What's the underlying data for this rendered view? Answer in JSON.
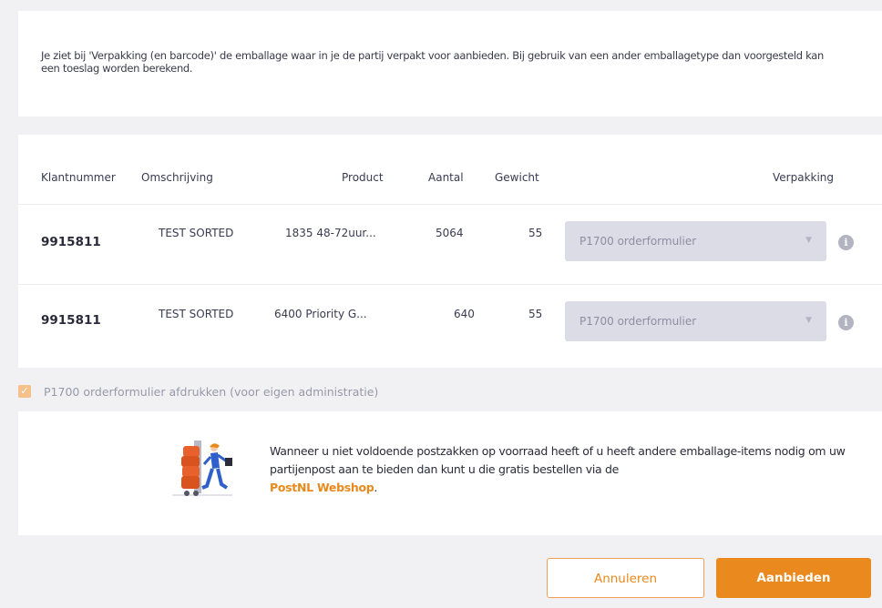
{
  "intro": {
    "text": "Je ziet bij 'Verpakking (en barcode)' de emballage waar in je de partij verpakt voor aanbieden. Bij gebruik van een ander emballagetype dan voorgesteld kan een toeslag worden berekend."
  },
  "table": {
    "headers": {
      "klantnummer": "Klantnummer",
      "omschrijving": "Omschrijving",
      "product": "Product",
      "aantal": "Aantal",
      "gewicht": "Gewicht",
      "verpakking": "Verpakking"
    },
    "rows": [
      {
        "klantnummer": "9915811",
        "omschrijving": "TEST SORTED",
        "product": "1835 48-72uur...",
        "aantal": "5064",
        "gewicht": "55",
        "verpakking": "P1700 orderformulier"
      },
      {
        "klantnummer": "9915811",
        "omschrijving": "TEST SORTED",
        "product": "6400 Priority G...",
        "aantal": "640",
        "gewicht": "55",
        "verpakking": "P1700 orderformulier"
      }
    ]
  },
  "print_option": {
    "label": "P1700 orderformulier afdrukken (voor eigen administratie)",
    "checked": true
  },
  "webshop": {
    "text": "Wanneer u niet voldoende postzakken op voorraad heeft of u heeft andere emballage-items nodig om uw partijenpost aan te bieden dan kunt u die gratis bestellen via de",
    "link_text": "PostNL Webshop",
    "suffix": "."
  },
  "buttons": {
    "cancel": "Annuleren",
    "submit": "Aanbieden"
  },
  "icons": {
    "info": "info-icon",
    "caret": "caret-down-icon",
    "check": "check-icon",
    "illustration": "courier-postbags-illustration"
  },
  "colors": {
    "accent": "#ea8a1e",
    "select_bg": "#dcdce6",
    "background": "#f1f1f3"
  }
}
